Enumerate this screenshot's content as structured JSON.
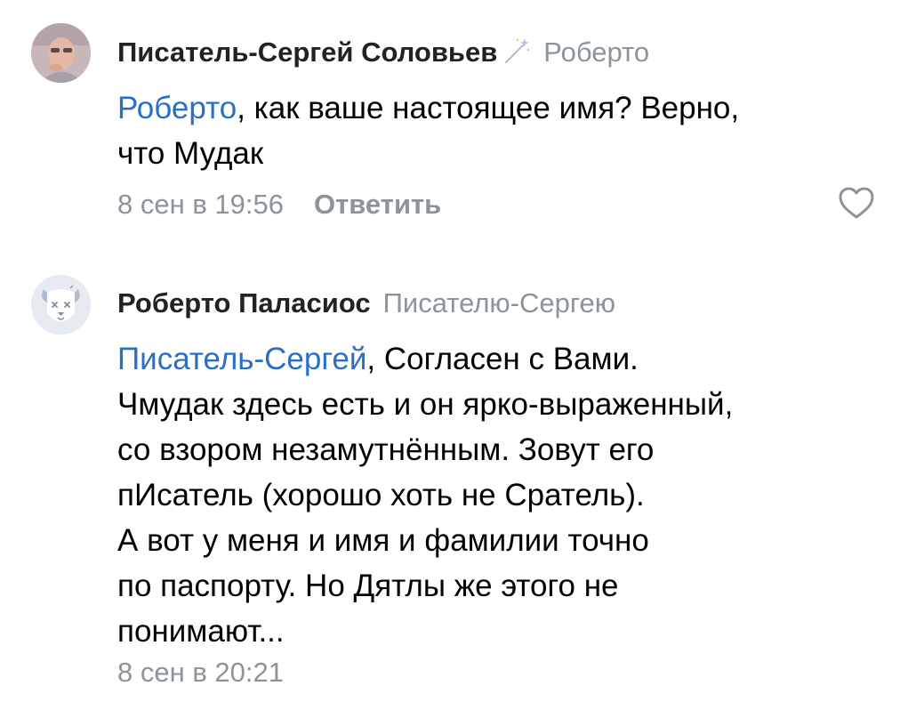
{
  "comments": [
    {
      "author": "Писатель-Сергей Соловьев",
      "author_icon": "magic-wand-icon",
      "reply_to": "Роберто",
      "mention": "Роберто",
      "text_lines": [
        ", как ваше настоящее имя? Верно,",
        "что Мудак"
      ],
      "date": "8 сен в 19:56",
      "reply_label": "Ответить",
      "like_icon": "heart-outline-icon"
    },
    {
      "author": "Роберто Паласиос",
      "reply_to": "Писателю-Сергею",
      "mention": "Писатель-Сергей",
      "text_lines": [
        ", Согласен с Вами.",
        "Чмудак здесь есть и он ярко-выраженный,",
        "со взором незамутнённым. Зовут его",
        "пИсатель (хорошо хоть не Сратель).",
        "А вот у меня и имя и фамилии точно",
        "по паспорту. Но Дятлы же этого не",
        "понимают..."
      ],
      "date": "8 сен в 20:21",
      "avatar_icon": "deactivated-dog-avatar-icon"
    }
  ],
  "colors": {
    "link": "#2a6fc2",
    "secondary_text": "#8c939a",
    "author_text": "#222222"
  }
}
